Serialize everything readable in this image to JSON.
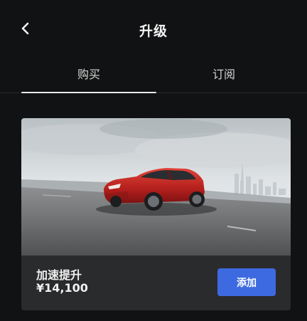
{
  "header": {
    "title": "升级",
    "back_icon": "chevron-left-icon"
  },
  "tabs": [
    {
      "label": "购买",
      "active": true
    },
    {
      "label": "订阅",
      "active": false
    }
  ],
  "upgrade_card": {
    "image": "red-suv-driving-on-road-photo",
    "name": "加速提升",
    "price": "¥14,100",
    "button_label": "添加",
    "button_color": "#3e6ae1"
  },
  "colors": {
    "background": "#111213",
    "card": "#2a2b2d",
    "accent": "#3e6ae1"
  }
}
